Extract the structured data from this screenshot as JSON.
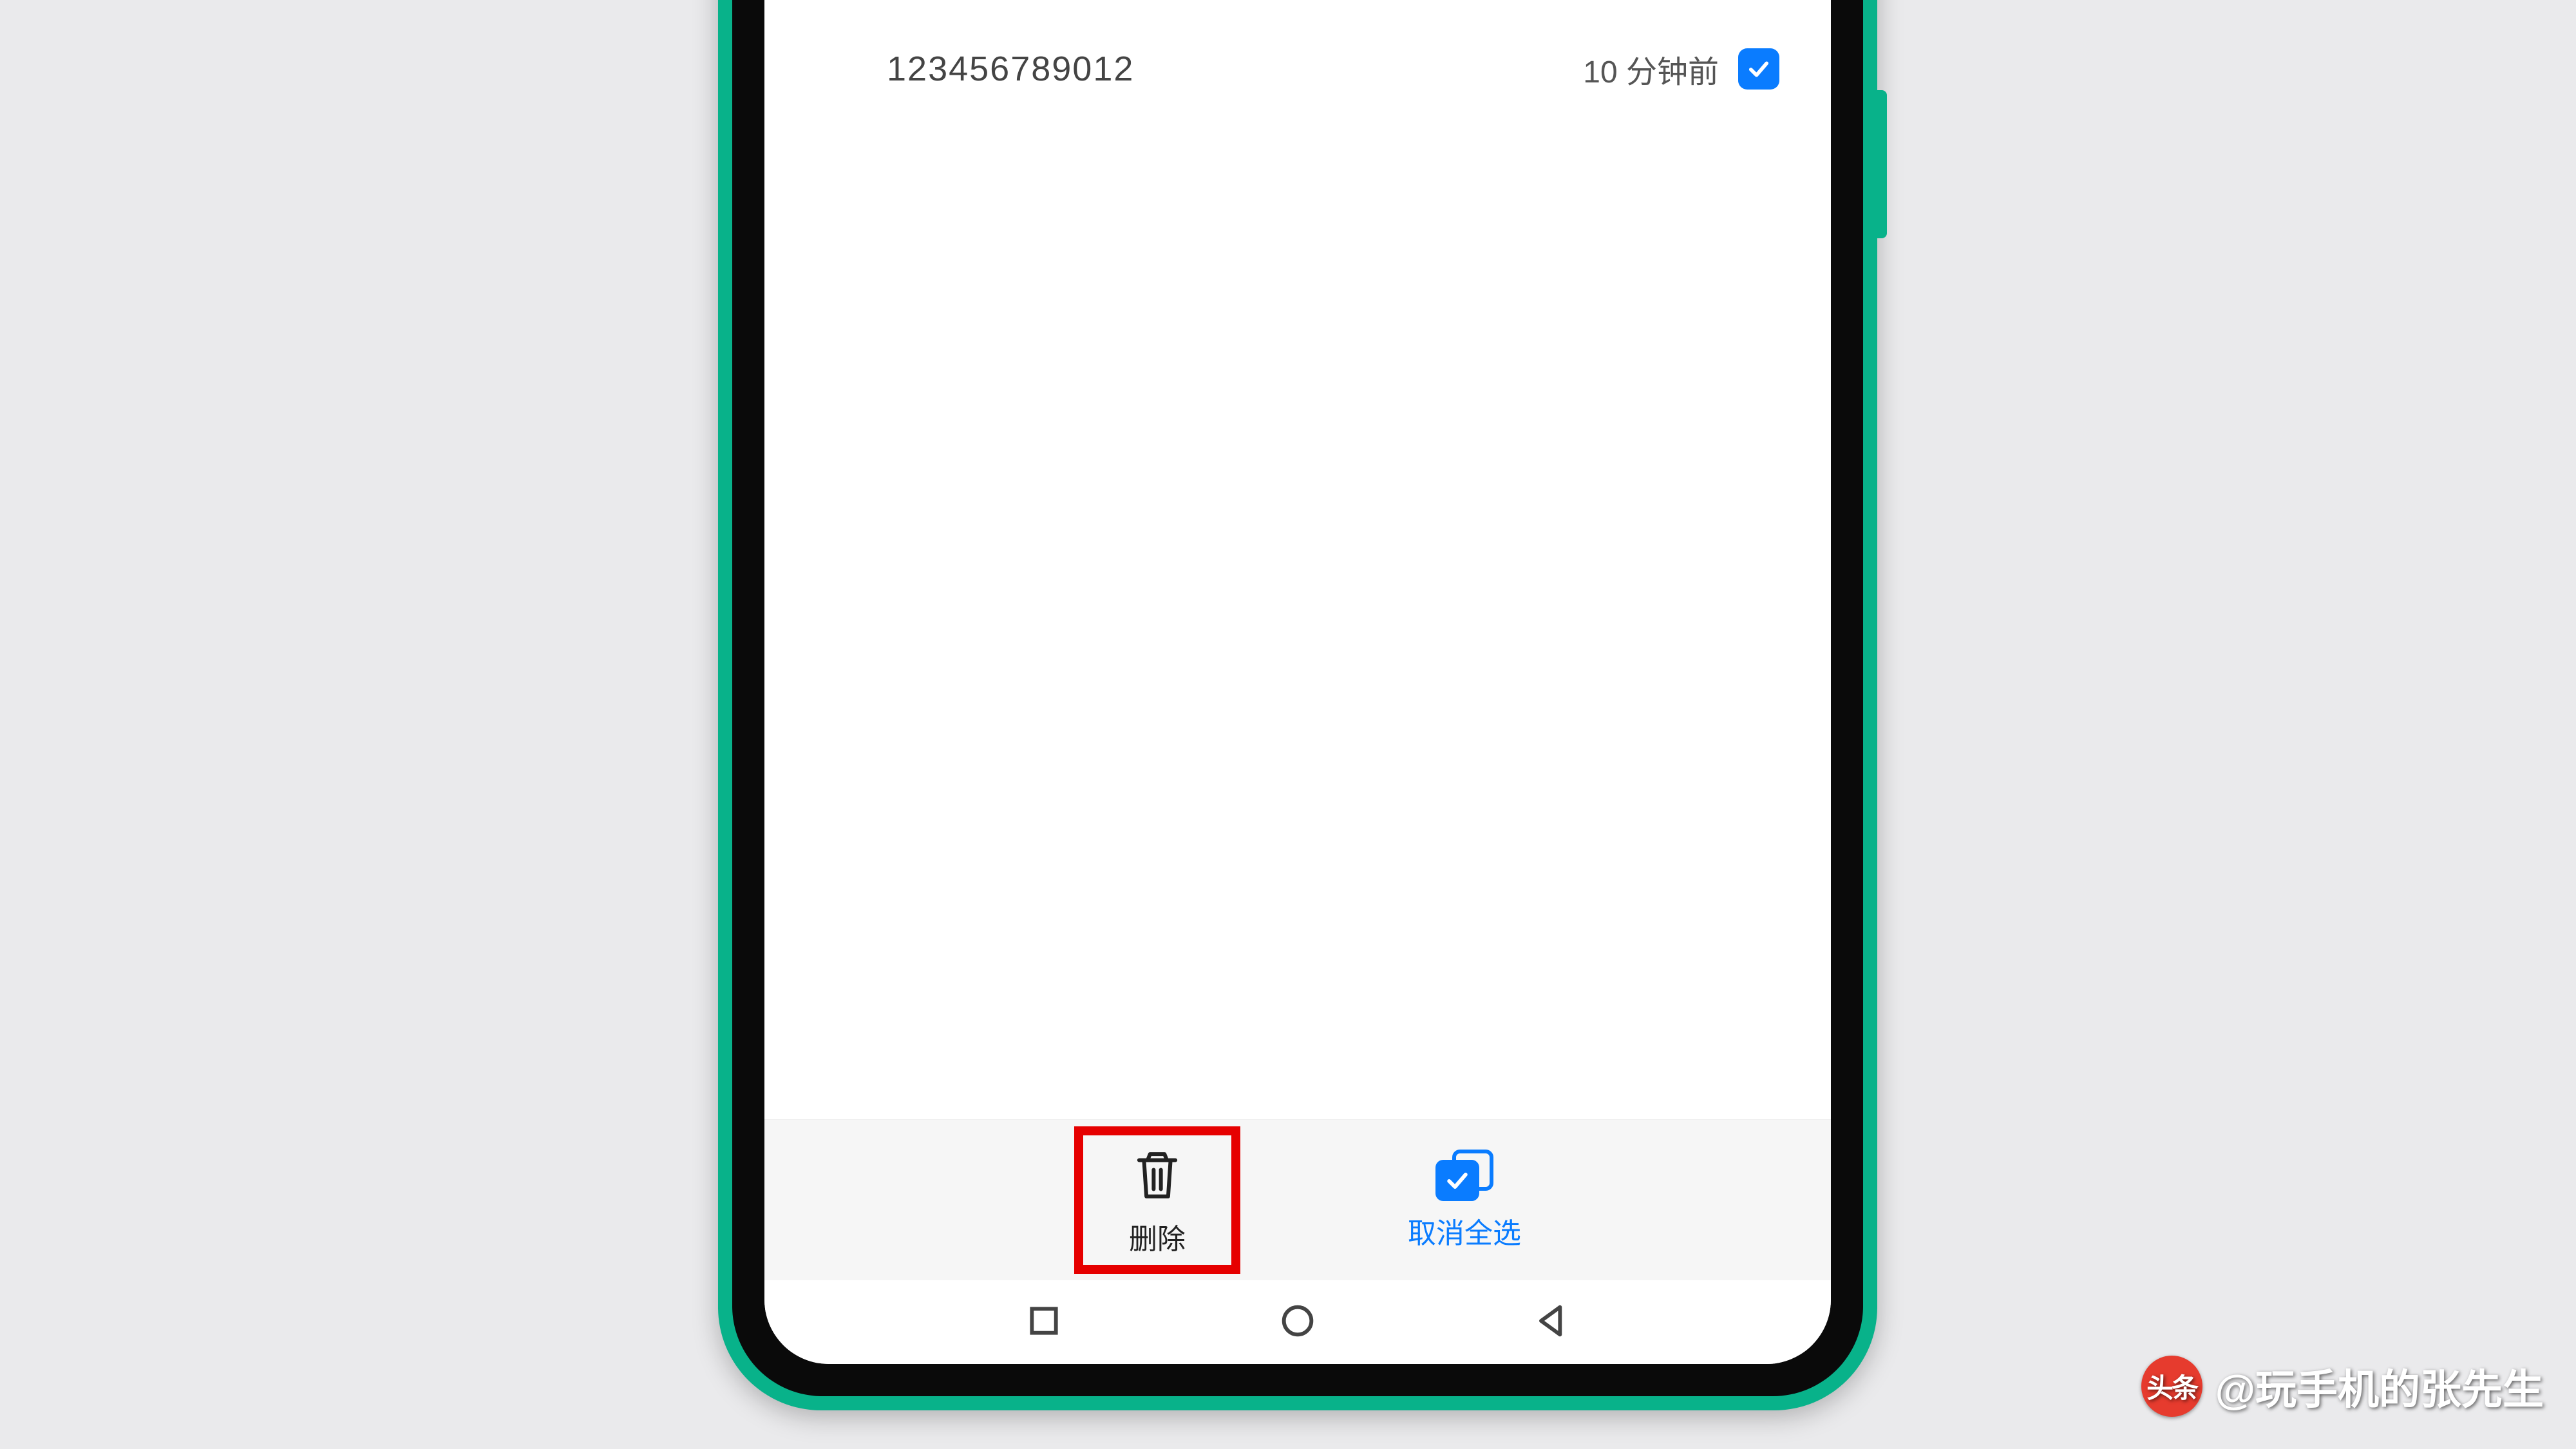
{
  "list": {
    "phone_number": "123456789012",
    "timestamp": "10 分钟前"
  },
  "toolbar": {
    "delete_label": "删除",
    "deselect_label": "取消全选"
  },
  "watermark": {
    "logo_text": "头条",
    "author": "@玩手机的张先生"
  }
}
